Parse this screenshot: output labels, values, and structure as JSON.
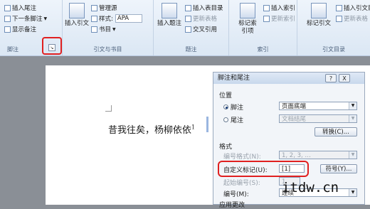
{
  "ribbon": {
    "footnotes_group": {
      "insert_endnote": "插入尾注",
      "next_footnote": "下一条脚注",
      "show_notes": "显示备注",
      "title": "脚注"
    },
    "citations_group": {
      "insert_citation": "插入引文",
      "manage_sources": "管理源",
      "style_label": "样式:",
      "style_value": "APA",
      "bibliography": "书目",
      "title": "引文与书目"
    },
    "captions_group": {
      "insert_caption": "插入题注",
      "insert_table_of_figures": "插入表目录",
      "update_table": "更新表格",
      "cross_reference": "交叉引用",
      "title": "题注"
    },
    "index_group": {
      "mark_entry": "标记索引项",
      "insert_index": "插入索引",
      "update_index": "更新索引",
      "title": "索引"
    },
    "toa_group": {
      "mark_citation": "标记引文",
      "insert_toa": "插入引文目",
      "update_table": "更新表格",
      "title": "引文目录"
    }
  },
  "document": {
    "text": "昔我往矣，杨柳依依",
    "footnote_ref": "1"
  },
  "dialog": {
    "title": "脚注和尾注",
    "help_btn": "?",
    "close_btn": "X",
    "location_label": "位置",
    "footnote_radio": "脚注",
    "footnote_value": "页面底端",
    "endnote_radio": "尾注",
    "endnote_value": "文档结尾",
    "convert_btn": "转换(C)...",
    "format_label": "格式",
    "number_format_label": "编号格式(N):",
    "number_format_value": "1, 2, 3, …",
    "custom_mark_label": "自定义标记(U):",
    "custom_mark_value": "[1]",
    "symbol_btn": "符号(Y)...",
    "start_at_label": "起始编号(S):",
    "start_at_value": "1",
    "numbering_label": "编号(M):",
    "numbering_value": "连续",
    "apply_label": "应用更改"
  },
  "watermark": "itdw.cn",
  "colors": {
    "highlight": "#e02020"
  }
}
